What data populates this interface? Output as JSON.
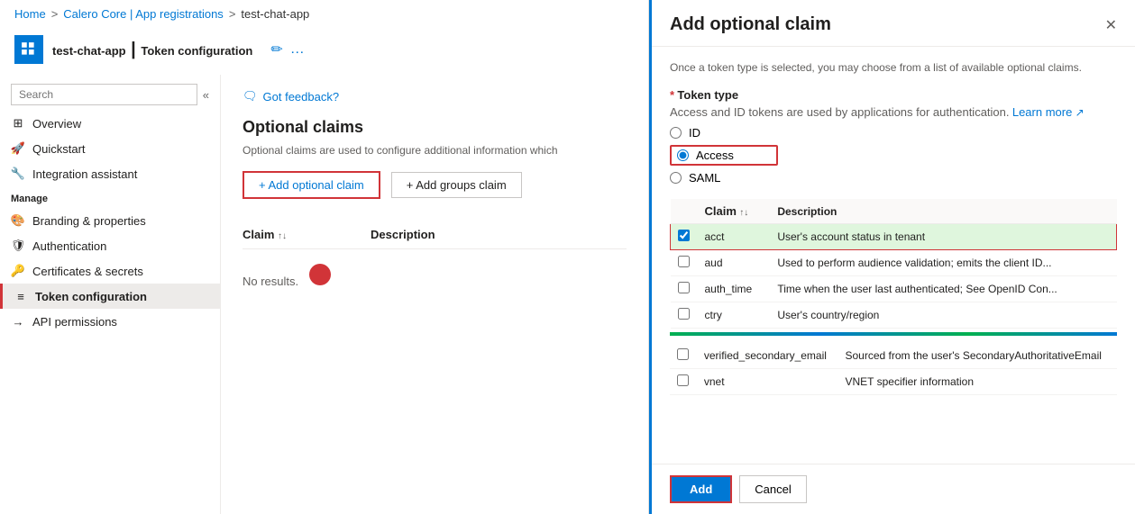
{
  "breadcrumb": {
    "home": "Home",
    "app_registrations": "Calero Core | App registrations",
    "app_name": "test-chat-app",
    "sep": ">"
  },
  "title_bar": {
    "app_name": "test-chat-app",
    "page": "Token configuration",
    "icon_edit": "✏",
    "icon_more": "…"
  },
  "sidebar": {
    "search_placeholder": "Search",
    "chevron": "«",
    "feedback_icon": "🗨",
    "feedback_label": "Got feedback?",
    "items": [
      {
        "id": "overview",
        "label": "Overview",
        "icon": "grid"
      },
      {
        "id": "quickstart",
        "label": "Quickstart",
        "icon": "rocket"
      },
      {
        "id": "integration",
        "label": "Integration assistant",
        "icon": "wrench"
      }
    ],
    "manage_label": "Manage",
    "manage_items": [
      {
        "id": "branding",
        "label": "Branding & properties",
        "icon": "palette"
      },
      {
        "id": "authentication",
        "label": "Authentication",
        "icon": "shield"
      },
      {
        "id": "certificates",
        "label": "Certificates & secrets",
        "icon": "key"
      },
      {
        "id": "token-config",
        "label": "Token configuration",
        "icon": "bars",
        "active": true
      },
      {
        "id": "api-permissions",
        "label": "API permissions",
        "icon": "arrow"
      }
    ]
  },
  "content": {
    "title": "Optional claims",
    "description": "Optional claims are used to configure additional information which",
    "btn_add_claim": "+ Add optional claim",
    "btn_add_groups": "+ Add groups claim",
    "table_col_claim": "Claim",
    "table_col_description": "Description",
    "no_results": "No results."
  },
  "modal": {
    "title": "Add optional claim",
    "close_icon": "✕",
    "description": "Once a token type is selected, you may choose from a list of available optional claims.",
    "token_type_label": "Token type",
    "token_type_required": "*",
    "token_type_hint": "Access and ID tokens are used by applications for authentication.",
    "learn_more_label": "Learn more",
    "token_options": [
      {
        "id": "id",
        "label": "ID",
        "selected": false
      },
      {
        "id": "access",
        "label": "Access",
        "selected": true
      },
      {
        "id": "saml",
        "label": "SAML",
        "selected": false
      }
    ],
    "claims_col_claim": "Claim",
    "claims_col_description": "Description",
    "claims": [
      {
        "id": "acct",
        "label": "acct",
        "description": "User's account status in tenant",
        "checked": true,
        "highlighted": true
      },
      {
        "id": "aud",
        "label": "aud",
        "description": "Used to perform audience validation; emits the client ID...",
        "checked": false,
        "highlighted": false
      },
      {
        "id": "auth_time",
        "label": "auth_time",
        "description": "Time when the user last authenticated; See OpenID Con...",
        "checked": false,
        "highlighted": false
      },
      {
        "id": "ctry",
        "label": "ctry",
        "description": "User's country/region",
        "checked": false,
        "highlighted": false
      }
    ],
    "claims_bottom": [
      {
        "id": "verified_secondary_email",
        "label": "verified_secondary_email",
        "description": "Sourced from the user's SecondaryAuthoritativeEmail",
        "checked": false
      },
      {
        "id": "vnet",
        "label": "vnet",
        "description": "VNET specifier information",
        "checked": false
      }
    ],
    "btn_add": "Add",
    "btn_cancel": "Cancel"
  }
}
